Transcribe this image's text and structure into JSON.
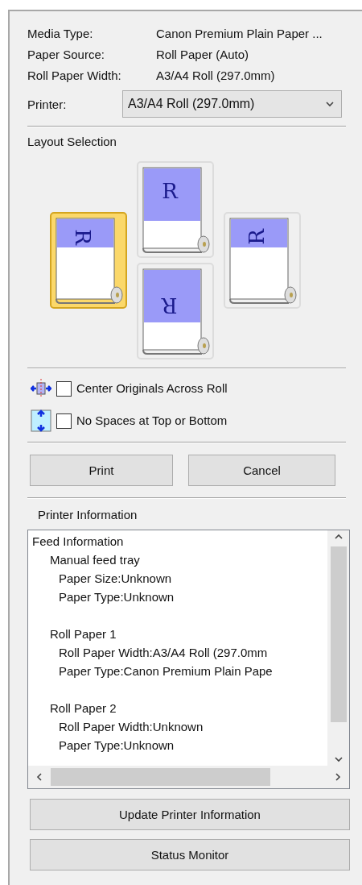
{
  "settings": [
    {
      "label": "Media Type:",
      "value": "Canon Premium Plain Paper ..."
    },
    {
      "label": "Paper Source:",
      "value": "Roll Paper (Auto)"
    },
    {
      "label": "Roll Paper Width:",
      "value": "A3/A4 Roll (297.0mm)"
    }
  ],
  "printer": {
    "label": "Printer:",
    "value": "A3/A4 Roll (297.0mm)"
  },
  "layout_selection": {
    "title": "Layout Selection",
    "options": [
      {
        "kind": "left",
        "letter": "R",
        "selected": true
      },
      {
        "kind": "up",
        "letter": "R",
        "selected": false
      },
      {
        "kind": "down",
        "letter": "R",
        "selected": false
      },
      {
        "kind": "right",
        "letter": "R",
        "selected": false
      }
    ]
  },
  "options": [
    {
      "kind": "center",
      "label": "Center Originals Across Roll",
      "checked": false
    },
    {
      "kind": "nospace",
      "label": "No Spaces at Top or Bottom",
      "checked": false
    }
  ],
  "buttons": [
    "Print",
    "Cancel"
  ],
  "printer_information": {
    "title": "Printer Information",
    "tree": [
      {
        "label": "Feed Information",
        "children": [
          {
            "label": "Manual feed tray",
            "children": [
              {
                "label": "Paper Size:Unknown"
              },
              {
                "label": "Paper Type:Unknown"
              }
            ]
          },
          {
            "label": "Roll Paper 1",
            "children": [
              {
                "label": "Roll Paper Width:A3/A4 Roll (297.0mm"
              },
              {
                "label": "Paper Type:Canon Premium Plain Pape"
              }
            ]
          },
          {
            "label": "Roll Paper 2",
            "children": [
              {
                "label": "Roll Paper Width:Unknown"
              },
              {
                "label": "Paper Type:Unknown"
              }
            ]
          }
        ]
      }
    ]
  },
  "bottom_buttons": [
    "Update Printer Information",
    "Status Monitor"
  ]
}
